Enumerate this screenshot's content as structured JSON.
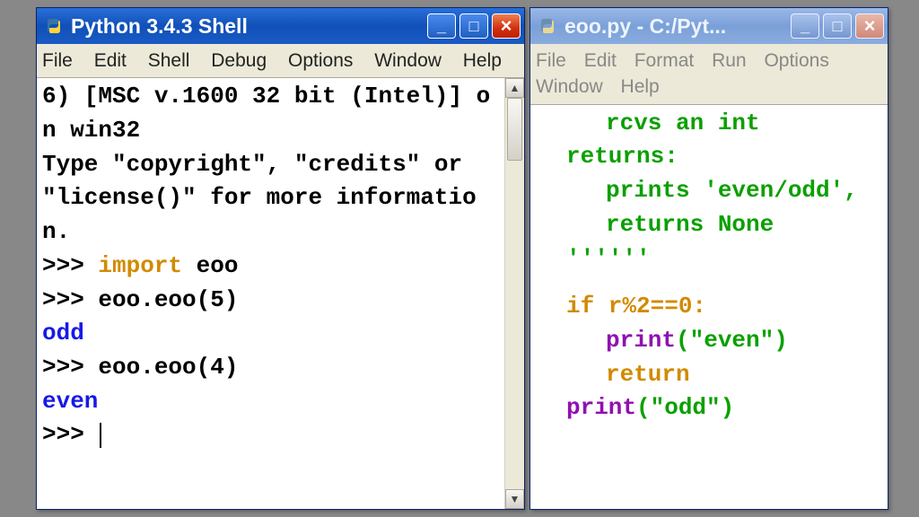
{
  "shell": {
    "title": "Python 3.4.3 Shell",
    "menus": [
      "File",
      "Edit",
      "Shell",
      "Debug",
      "Options",
      "Window",
      "Help"
    ],
    "banner_line1": "6) [MSC v.1600 32 bit (Intel)] on win32",
    "banner_line2": "Type \"copyright\", \"credits\" or \"license()\" for more information.",
    "prompt": ">>> ",
    "import_kw": "import",
    "import_mod": " eoo",
    "call1": "eoo.eoo(5)",
    "out1": "odd",
    "call2": "eoo.eoo(4)",
    "out2": "even"
  },
  "editor": {
    "title": "eoo.py - C:/Pyt...",
    "menus": [
      "File",
      "Edit",
      "Format",
      "Run",
      "Options",
      "Window",
      "Help"
    ],
    "doc_l1": "rcvs an int",
    "doc_l2": "returns:",
    "doc_l3": "prints 'even/odd',",
    "doc_l4": "returns None",
    "doc_end": "''''''",
    "if_head": "if r%2==0:",
    "print_fn": "print",
    "even_str": "(\"even\")",
    "return_kw": "return",
    "odd_str": "(\"odd\")"
  }
}
